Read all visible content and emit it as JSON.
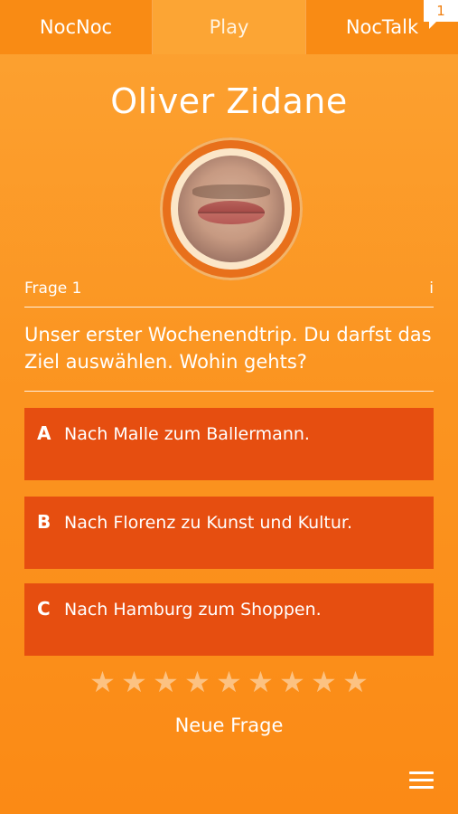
{
  "tabs": {
    "nocnoc": "NocNoc",
    "play": "Play",
    "noctalk": "NocTalk",
    "noctalk_badge": "1"
  },
  "profile": {
    "name": "Oliver Zidane"
  },
  "question": {
    "label": "Frage 1",
    "info": "i",
    "text": "Unser erster Wochenendtrip. Du darfst das Ziel auswählen. Wohin gehts?"
  },
  "answers": [
    {
      "letter": "A",
      "text": "Nach Malle zum Ballermann."
    },
    {
      "letter": "B",
      "text": "Nach Florenz zu Kunst und Kultur."
    },
    {
      "letter": "C",
      "text": "Nach Hamburg zum Shoppen."
    }
  ],
  "rating": {
    "max": 9,
    "value": 0,
    "star_glyph": "★"
  },
  "actions": {
    "new_question": "Neue Frage"
  },
  "colors": {
    "background": "#fb9521",
    "answer_bg": "#e64e10",
    "star": "#fcc282"
  }
}
